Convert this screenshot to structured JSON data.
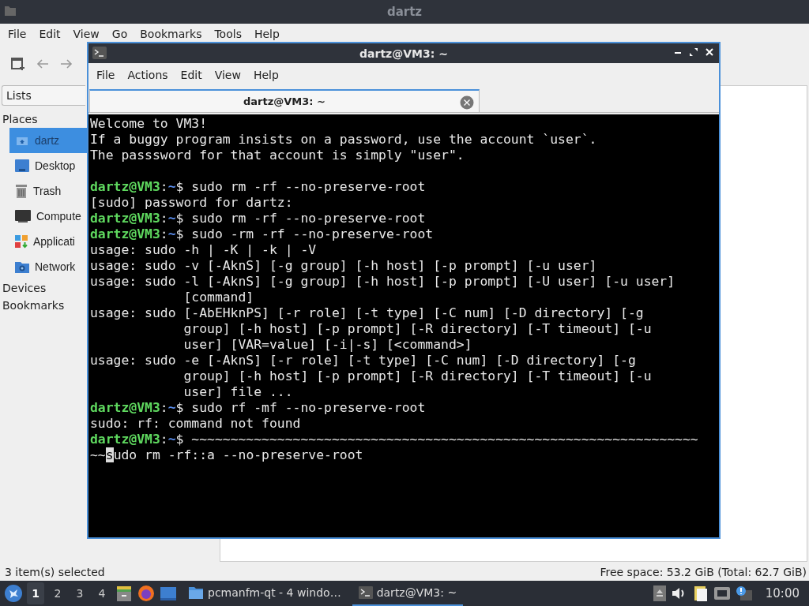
{
  "file_manager": {
    "title": "dartz",
    "menu": [
      "File",
      "Edit",
      "View",
      "Go",
      "Bookmarks",
      "Tools",
      "Help"
    ],
    "sidebar": {
      "view_mode": "Lists",
      "sections": [
        {
          "label": "Places",
          "items": [
            {
              "label": "dartz",
              "kind": "home",
              "selected": true
            },
            {
              "label": "Desktop",
              "kind": "desktop",
              "selected": false
            },
            {
              "label": "Trash",
              "kind": "trash",
              "selected": false
            },
            {
              "label": "Compute",
              "kind": "computer",
              "selected": false
            },
            {
              "label": "Applicati",
              "kind": "apps",
              "selected": false
            },
            {
              "label": "Network",
              "kind": "network",
              "selected": false
            }
          ]
        },
        {
          "label": "Devices"
        },
        {
          "label": "Bookmarks"
        }
      ]
    },
    "status_bar": {
      "left": "3 item(s) selected",
      "right": "Free space: 53.2 GiB (Total: 62.7 GiB)"
    }
  },
  "terminal": {
    "title": "dartz@VM3: ~",
    "menu": [
      "File",
      "Actions",
      "Edit",
      "View",
      "Help"
    ],
    "tabs": [
      {
        "label": "dartz@VM3: ~",
        "selected": true
      }
    ],
    "lines": [
      {
        "kind": "output",
        "text": "Welcome to VM3!"
      },
      {
        "kind": "output",
        "text": "If a buggy program insists on a password, use the account `user`."
      },
      {
        "kind": "output",
        "text": "The passsword for that account is simply \"user\"."
      },
      {
        "kind": "blank"
      },
      {
        "kind": "prompt",
        "user": "dartz@VM3",
        "separator": ":",
        "path": "~",
        "symbol": "$",
        "command": "sudo rm -rf --no-preserve-root"
      },
      {
        "kind": "output",
        "text": "[sudo] password for dartz:"
      },
      {
        "kind": "prompt",
        "user": "dartz@VM3",
        "separator": ":",
        "path": "~",
        "symbol": "$",
        "command": "sudo rm -rf --no-preserve-root"
      },
      {
        "kind": "prompt",
        "user": "dartz@VM3",
        "separator": ":",
        "path": "~",
        "symbol": "$",
        "command": "sudo -rm -rf --no-preserve-root"
      },
      {
        "kind": "output",
        "text": "usage: sudo -h | -K | -k | -V"
      },
      {
        "kind": "output",
        "text": "usage: sudo -v [-AknS] [-g group] [-h host] [-p prompt] [-u user]"
      },
      {
        "kind": "output",
        "text": "usage: sudo -l [-AknS] [-g group] [-h host] [-p prompt] [-U user] [-u user]"
      },
      {
        "kind": "output",
        "text": "            [command]"
      },
      {
        "kind": "output",
        "text": "usage: sudo [-AbEHknPS] [-r role] [-t type] [-C num] [-D directory] [-g"
      },
      {
        "kind": "output",
        "text": "            group] [-h host] [-p prompt] [-R directory] [-T timeout] [-u"
      },
      {
        "kind": "output",
        "text": "            user] [VAR=value] [-i|-s] [<command>]"
      },
      {
        "kind": "output",
        "text": "usage: sudo -e [-AknS] [-r role] [-t type] [-C num] [-D directory] [-g"
      },
      {
        "kind": "output",
        "text": "            group] [-h host] [-p prompt] [-R directory] [-T timeout] [-u"
      },
      {
        "kind": "output",
        "text": "            user] file ..."
      },
      {
        "kind": "prompt",
        "user": "dartz@VM3",
        "separator": ":",
        "path": "~",
        "symbol": "$",
        "command": "sudo rf -mf --no-preserve-root"
      },
      {
        "kind": "output",
        "text": "sudo: rf: command not found"
      },
      {
        "kind": "prompt",
        "user": "dartz@VM3",
        "separator": ":",
        "path": "~",
        "symbol": "$",
        "command": "~~~~~~~~~~~~~~~~~~~~~~~~~~~~~~~~~~~~~~~~~~~~~~~~~~~~~~~~~~~~~~~~~"
      },
      {
        "kind": "input",
        "before": "~~",
        "cursor": "s",
        "after": "udo rm -rf::a --no-preserve-root"
      }
    ]
  },
  "taskbar": {
    "workspaces": [
      {
        "label": "1",
        "selected": true
      },
      {
        "label": "2",
        "selected": false
      },
      {
        "label": "3",
        "selected": false
      },
      {
        "label": "4",
        "selected": false
      }
    ],
    "tasks": [
      {
        "label": "pcmanfm-qt - 4 windo…",
        "kind": "folder",
        "selected": false
      },
      {
        "label": "dartz@VM3: ~",
        "kind": "terminal",
        "selected": true
      }
    ],
    "clock": "10:00"
  }
}
